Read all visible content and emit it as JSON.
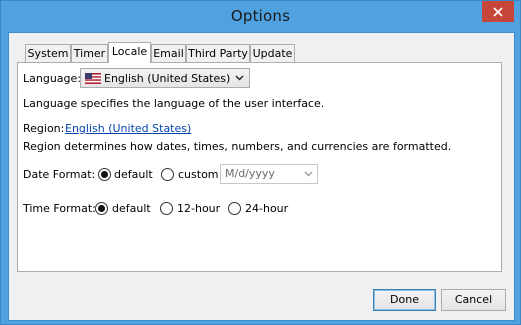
{
  "window": {
    "title": "Options"
  },
  "tabs": [
    {
      "label": "System"
    },
    {
      "label": "Timer"
    },
    {
      "label": "Locale"
    },
    {
      "label": "Email"
    },
    {
      "label": "Third Party"
    },
    {
      "label": "Update"
    }
  ],
  "active_tab": "Locale",
  "locale": {
    "language_label": "Language:",
    "language_value": "English (United States)",
    "language_desc": "Language specifies the language of the user interface.",
    "region_label": "Region:",
    "region_value": "English (United States)",
    "region_desc": "Region determines how dates, times, numbers, and currencies are formatted.",
    "date_format_label": "Date Format:",
    "date_options": [
      "default",
      "custom"
    ],
    "date_selected": "default",
    "date_custom_value": "M/d/yyyy",
    "time_format_label": "Time Format:",
    "time_options": [
      "default",
      "12-hour",
      "24-hour"
    ],
    "time_selected": "default"
  },
  "buttons": {
    "done": "Done",
    "cancel": "Cancel"
  },
  "colors": {
    "titlebar": "#4fa1e0",
    "close": "#c7463a",
    "link": "#0645ad"
  }
}
